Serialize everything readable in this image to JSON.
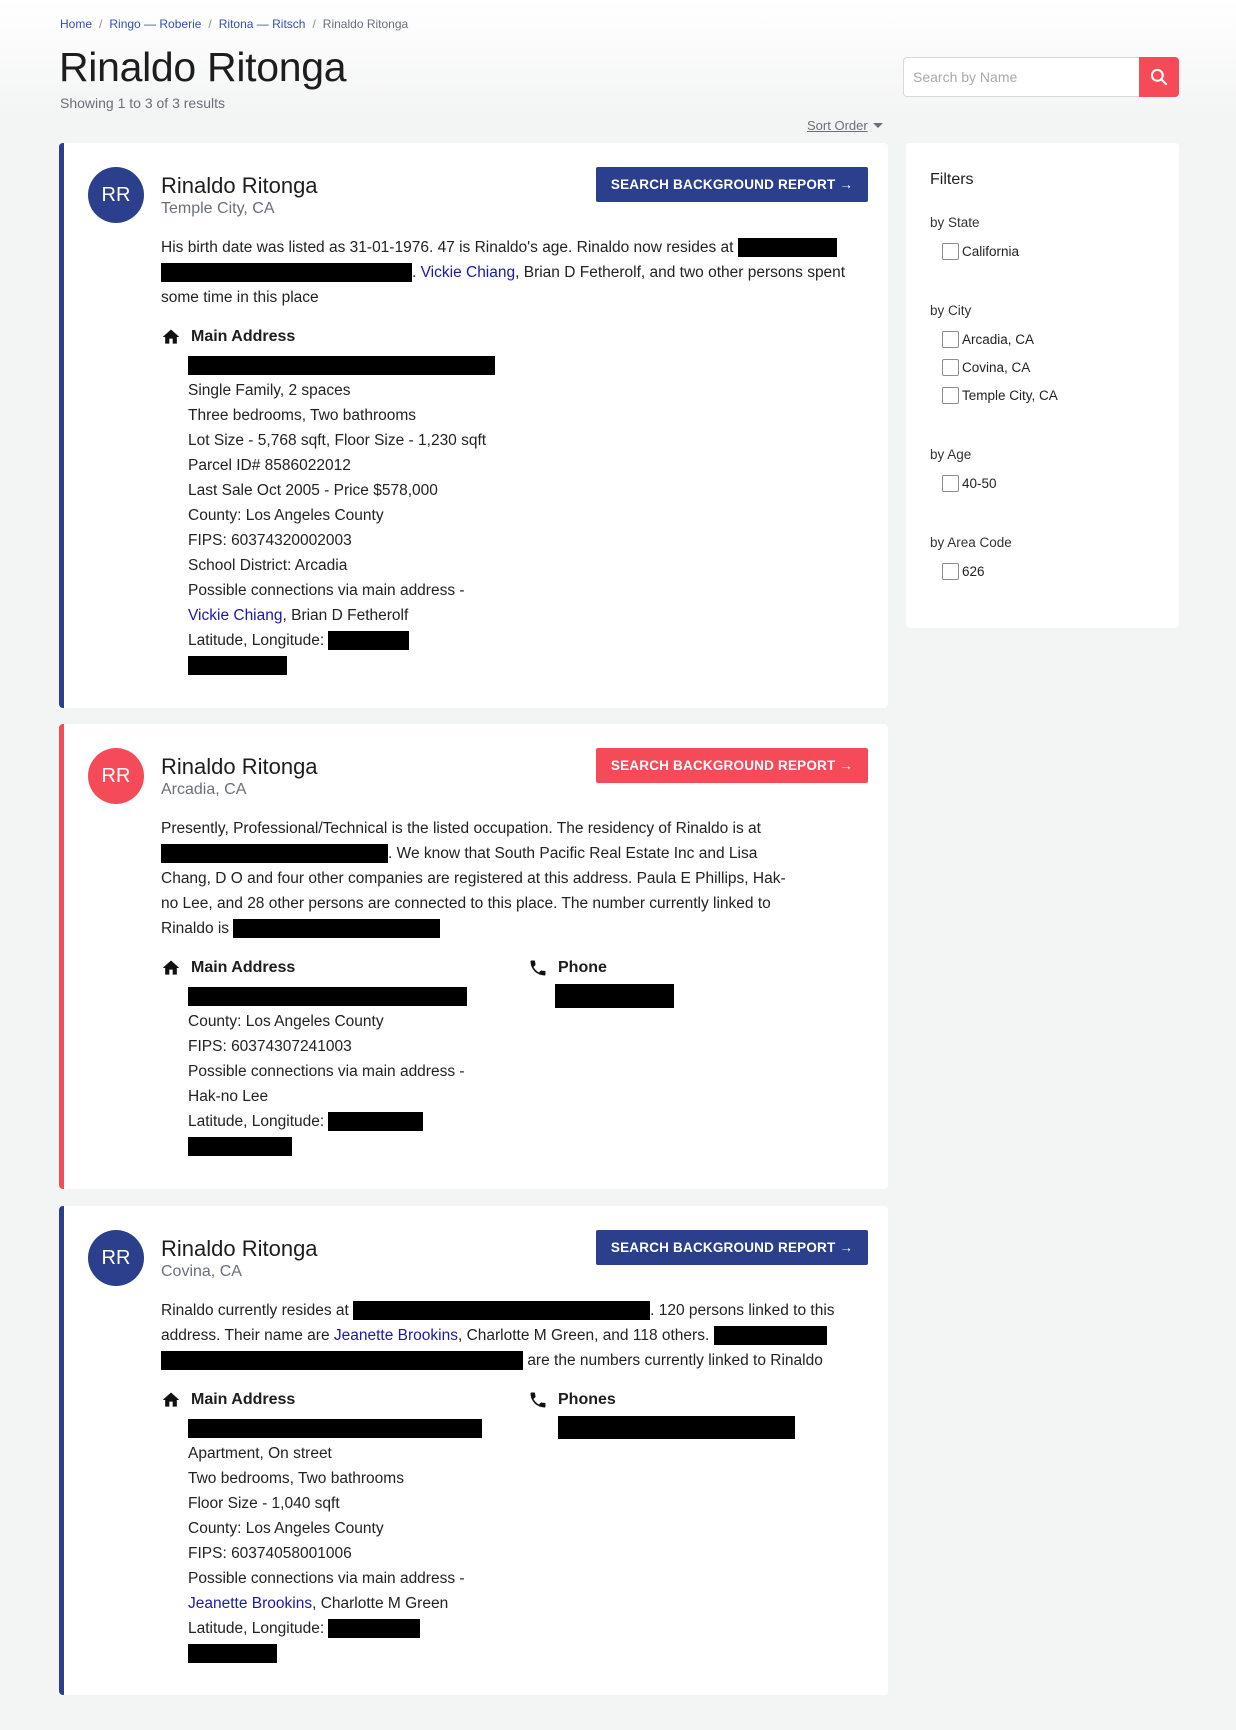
{
  "breadcrumb": {
    "home": "Home",
    "level1": "Ringo — Roberie",
    "level2": "Ritona — Ritsch",
    "current": "Rinaldo Ritonga",
    "separator": "/"
  },
  "header": {
    "title": "Rinaldo Ritonga",
    "results": "Showing 1 to 3 of 3 results"
  },
  "search": {
    "placeholder": "Search by Name"
  },
  "sort": {
    "label": "Sort Order"
  },
  "report_button": "SEARCH BACKGROUND REPORT →",
  "results": [
    {
      "initials": "RR",
      "name": "Rinaldo Ritonga",
      "location": "Temple City, CA",
      "summary": {
        "t1": "His birth date was listed as 31-01-1976. 47 is Rinaldo's age. Rinaldo now resides at",
        "t2": ".",
        "link1": "Vickie Chiang",
        "t3": ", Brian D Fetherolf, and two other persons spent some time in this place"
      },
      "address_label": "Main Address",
      "details": {
        "d1": "Single Family, 2 spaces",
        "d2": "Three bedrooms, Two bathrooms",
        "d3": "Lot Size - 5,768 sqft, Floor Size - 1,230 sqft",
        "d4": "Parcel ID# 8586022012",
        "d5": "Last Sale Oct 2005 - Price $578,000",
        "d6": "County: Los Angeles County",
        "d7": "FIPS: 60374320002003",
        "d8": "School District: Arcadia",
        "d9": "Possible connections via main address -",
        "conn_link": "Vickie Chiang",
        "conn_rest": ", Brian D Fetherolf",
        "latlng": "Latitude, Longitude:"
      }
    },
    {
      "initials": "RR",
      "name": "Rinaldo Ritonga",
      "location": "Arcadia, CA",
      "summary": {
        "t1": "Presently, Professional/Technical is the listed occupation. The residency of Rinaldo is at",
        "t2": ". We know that South Pacific Real Estate Inc and Lisa Chang, D O and four other companies are registered at this address. Paula E Phillips, Hak-no Lee, and 28 other persons are connected to this place. The number currently linked to Rinaldo is"
      },
      "address_label": "Main Address",
      "phone_label": "Phone",
      "details": {
        "d1": "County: Los Angeles County",
        "d2": "FIPS: 60374307241003",
        "d3": "Possible connections via main address -",
        "d4": "Hak-no Lee",
        "latlng": "Latitude, Longitude:"
      }
    },
    {
      "initials": "RR",
      "name": "Rinaldo Ritonga",
      "location": "Covina, CA",
      "summary": {
        "t1": "Rinaldo currently resides at",
        "t2": ". 120 persons linked to this address. Their name are",
        "link1": "Jeanette Brookins",
        "t3": ", Charlotte M Green, and 118 others.",
        "t4": "are the numbers currently linked to Rinaldo"
      },
      "address_label": "Main Address",
      "phone_label": "Phones",
      "details": {
        "d1": "Apartment, On street",
        "d2": "Two bedrooms, Two bathrooms",
        "d3": "Floor Size - 1,040 sqft",
        "d4": "County: Los Angeles County",
        "d5": "FIPS: 60374058001006",
        "d6": "Possible connections via main address -",
        "conn_link": "Jeanette Brookins",
        "conn_rest": ", Charlotte M Green",
        "latlng": "Latitude, Longitude:"
      }
    }
  ],
  "filters": {
    "title": "Filters",
    "state_label": "by State",
    "state_options": [
      "California"
    ],
    "city_label": "by City",
    "city_options": [
      "Arcadia, CA",
      "Covina, CA",
      "Temple City, CA"
    ],
    "age_label": "by Age",
    "age_options": [
      "40-50"
    ],
    "area_label": "by Area Code",
    "area_options": [
      "626"
    ]
  },
  "colors": {
    "primary": "#2b3f8c",
    "accent": "#f54b58",
    "link": "#1a1aa6"
  },
  "icons": {
    "search": "magnifier-icon",
    "home": "home-icon",
    "phone": "phone-icon",
    "caret": "caret-down-icon"
  }
}
